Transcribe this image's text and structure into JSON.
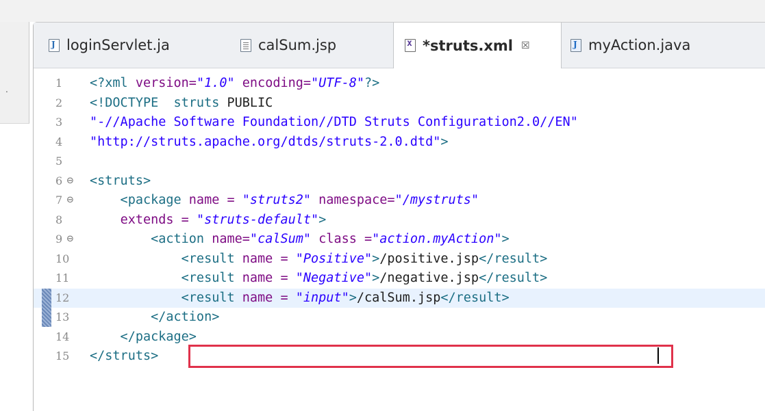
{
  "tabs": [
    {
      "label": "loginServlet.ja",
      "icon": "java-file-icon",
      "active": false
    },
    {
      "label": "calSum.jsp",
      "icon": "jsp-file-icon",
      "active": false
    },
    {
      "label": "*struts.xml",
      "icon": "xml-file-icon",
      "active": true,
      "close": "☒"
    },
    {
      "label": "myAction.java",
      "icon": "java-file-icon",
      "active": false
    }
  ],
  "editor": {
    "current_line": 12,
    "lines": [
      {
        "num": "1",
        "t": [
          [
            "<?xml ",
            "pi"
          ],
          [
            "version=",
            "attr"
          ],
          [
            "\"",
            "str2"
          ],
          [
            "1.0",
            "str"
          ],
          [
            "\" ",
            "str2"
          ],
          [
            "encoding=",
            "attr"
          ],
          [
            "\"",
            "str2"
          ],
          [
            "UTF-8",
            "str"
          ],
          [
            "\"",
            "str2"
          ],
          [
            "?>",
            "pi"
          ]
        ]
      },
      {
        "num": "2",
        "t": [
          [
            "<!DOCTYPE  struts ",
            "doctype"
          ],
          [
            "PUBLIC",
            "plain"
          ]
        ]
      },
      {
        "num": "3",
        "t": [
          [
            "\"-//Apache Software Foundation//DTD Struts Configuration2.0//EN\"",
            "str2"
          ]
        ]
      },
      {
        "num": "4",
        "t": [
          [
            "\"http://struts.apache.org/dtds/struts-2.0.dtd\"",
            "str2"
          ],
          [
            ">",
            "tag"
          ]
        ]
      },
      {
        "num": "5",
        "t": []
      },
      {
        "num": "6",
        "fold": true,
        "t": [
          [
            "<struts>",
            "tag"
          ]
        ]
      },
      {
        "num": "7",
        "fold": true,
        "t": [
          [
            "    <package ",
            "tag"
          ],
          [
            "name = ",
            "attr"
          ],
          [
            "\"",
            "str2"
          ],
          [
            "struts2",
            "str"
          ],
          [
            "\" ",
            "str2"
          ],
          [
            "namespace=",
            "attr"
          ],
          [
            "\"",
            "str2"
          ],
          [
            "/mystruts",
            "str"
          ],
          [
            "\"",
            "str2"
          ]
        ]
      },
      {
        "num": "8",
        "t": [
          [
            "    ",
            "plain"
          ],
          [
            "extends = ",
            "attr"
          ],
          [
            "\"",
            "str2"
          ],
          [
            "struts-default",
            "str"
          ],
          [
            "\"",
            "str2"
          ],
          [
            ">",
            "tag"
          ]
        ]
      },
      {
        "num": "9",
        "fold": true,
        "t": [
          [
            "        <action ",
            "tag"
          ],
          [
            "name=",
            "attr"
          ],
          [
            "\"",
            "str2"
          ],
          [
            "calSum",
            "str"
          ],
          [
            "\" ",
            "str2"
          ],
          [
            "class =",
            "attr"
          ],
          [
            "\"",
            "str2"
          ],
          [
            "action.myAction",
            "str"
          ],
          [
            "\"",
            "str2"
          ],
          [
            ">",
            "tag"
          ]
        ]
      },
      {
        "num": "10",
        "t": [
          [
            "            <result ",
            "tag"
          ],
          [
            "name = ",
            "attr"
          ],
          [
            "\"",
            "str2"
          ],
          [
            "Positive",
            "str"
          ],
          [
            "\"",
            "str2"
          ],
          [
            ">",
            "tag"
          ],
          [
            "/positive.jsp",
            "plain"
          ],
          [
            "</result>",
            "tag"
          ]
        ]
      },
      {
        "num": "11",
        "t": [
          [
            "            <result ",
            "tag"
          ],
          [
            "name = ",
            "attr"
          ],
          [
            "\"",
            "str2"
          ],
          [
            "Negative",
            "str"
          ],
          [
            "\"",
            "str2"
          ],
          [
            ">",
            "tag"
          ],
          [
            "/negative.jsp",
            "plain"
          ],
          [
            "</result>",
            "tag"
          ]
        ]
      },
      {
        "num": "12",
        "t": [
          [
            "            <result ",
            "tag"
          ],
          [
            "name = ",
            "attr"
          ],
          [
            "\"",
            "str2"
          ],
          [
            "input",
            "str"
          ],
          [
            "\"",
            "str2"
          ],
          [
            ">",
            "tag"
          ],
          [
            "/calSum.jsp",
            "plain"
          ],
          [
            "</result>",
            "tag"
          ]
        ]
      },
      {
        "num": "13",
        "t": [
          [
            "        </action>",
            "tag"
          ]
        ]
      },
      {
        "num": "14",
        "t": [
          [
            "    </package>",
            "tag"
          ]
        ]
      },
      {
        "num": "15",
        "t": [
          [
            "</struts>",
            "tag"
          ]
        ]
      }
    ]
  }
}
